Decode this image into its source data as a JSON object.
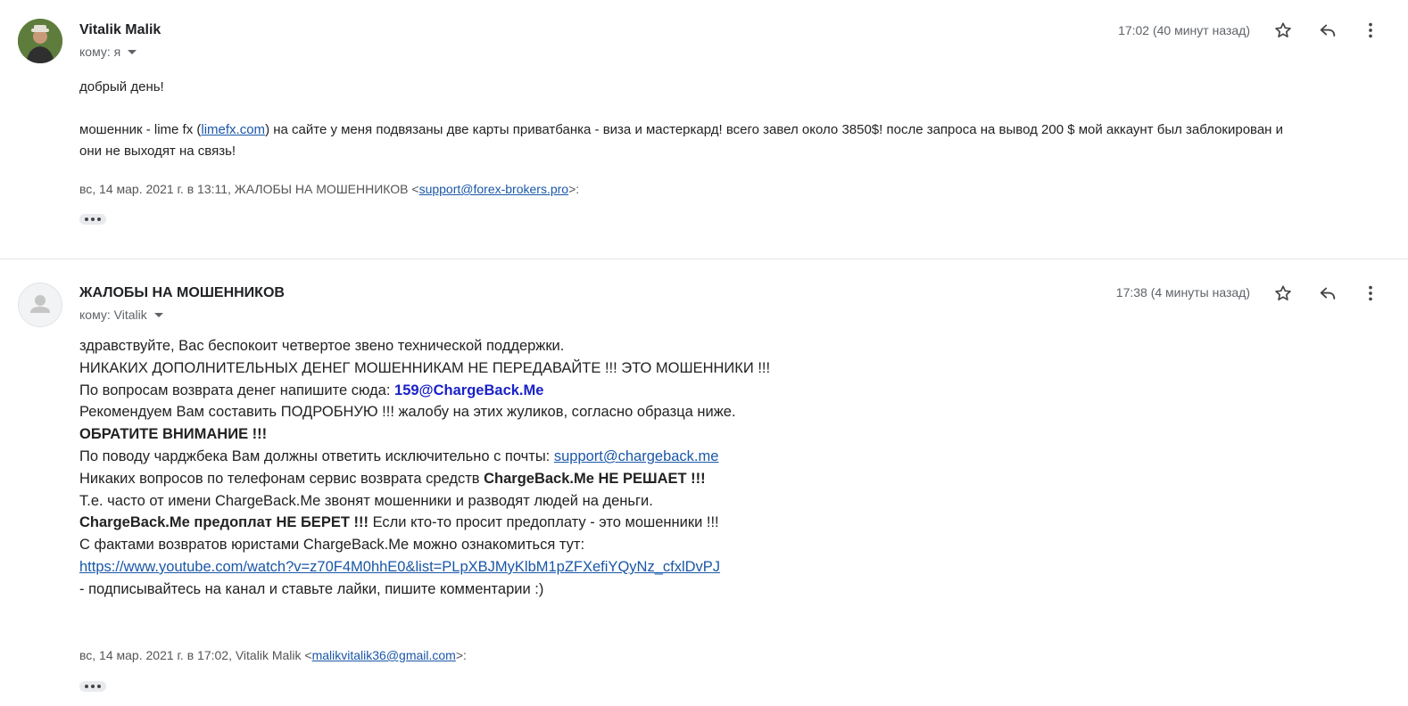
{
  "messages": [
    {
      "sender": "Vitalik Malik",
      "to_label": "кому: я",
      "time": "17:02 (40 минут назад)",
      "greeting": "добрый день!",
      "body_pre": "мошенник - lime fx (",
      "body_link": "limefx.com",
      "body_post": ")  на сайте у меня подвязаны две карты приватбанка - виза и мастеркард! всего завел около 3850$! после запроса на вывод 200 $ мой аккаунт был заблокирован и",
      "body_line2": "они не выходят на связь!",
      "quote_pre": "вс, 14 мар. 2021 г. в 13:11, ЖАЛОБЫ НА МОШЕННИКОВ <",
      "quote_email": "support@forex-brokers.pro",
      "quote_post": ">:"
    },
    {
      "sender": "ЖАЛОБЫ НА МОШЕННИКОВ",
      "to_label": "кому: Vitalik",
      "time": "17:38 (4 минуты назад)",
      "l1": "здравствуйте, Вас беспокоит четвертое звено технической поддержки.",
      "l2": "НИКАКИХ ДОПОЛНИТЕЛЬНЫХ ДЕНЕГ МОШЕННИКАМ НЕ ПЕРЕДАВАЙТЕ !!! ЭТО МОШЕННИКИ !!!",
      "l3_pre": "По вопросам возврата денег напишите сюда: ",
      "l3_email": "159@ChargeBack.Me",
      "l4": "Рекомендуем Вам составить ПОДРОБНУЮ !!! жалобу на этих жуликов, согласно образца ниже.",
      "l5": "ОБРАТИТЕ ВНИМАНИЕ !!!",
      "l6_pre": "По поводу чарджбека Вам должны ответить исключительно с почты: ",
      "l6_email": "support@chargeback.me",
      "l7_pre": "Никаких вопросов по телефонам сервис возврата средств ",
      "l7_bold": "ChargeBack.Me НЕ РЕШАЕТ !!!",
      "l8": "Т.е. часто от имени ChargeBack.Me звонят мошенники и разводят людей на деньги.",
      "l9_bold": "ChargeBack.Me предоплат НЕ БЕРЕТ !!!",
      "l9_post": " Если кто-то просит предоплату - это мошенники !!!",
      "l10": "С фактами возвратов юристами ChargeBack.Me можно ознакомиться тут:",
      "l11_link": "https://www.youtube.com/watch?v=z70F4M0hhE0&list=PLpXBJMyKlbM1pZFXefiYQyNz_cfxlDvPJ",
      "l12": " - подписывайтесь на канал и ставьте лайки, пишите комментарии :)",
      "quote_pre": "вс, 14 мар. 2021 г. в 17:02, Vitalik Malik <",
      "quote_email": "malikvitalik36@gmail.com",
      "quote_post": ">:"
    }
  ],
  "icons": {
    "star": "star-icon",
    "reply": "reply-icon",
    "more": "more-vert-icon",
    "expand": "more-horiz-icon"
  },
  "colors": {
    "link": "#1a57a8",
    "email_highlight": "#1a21c7",
    "meta_text": "#5f6368"
  }
}
